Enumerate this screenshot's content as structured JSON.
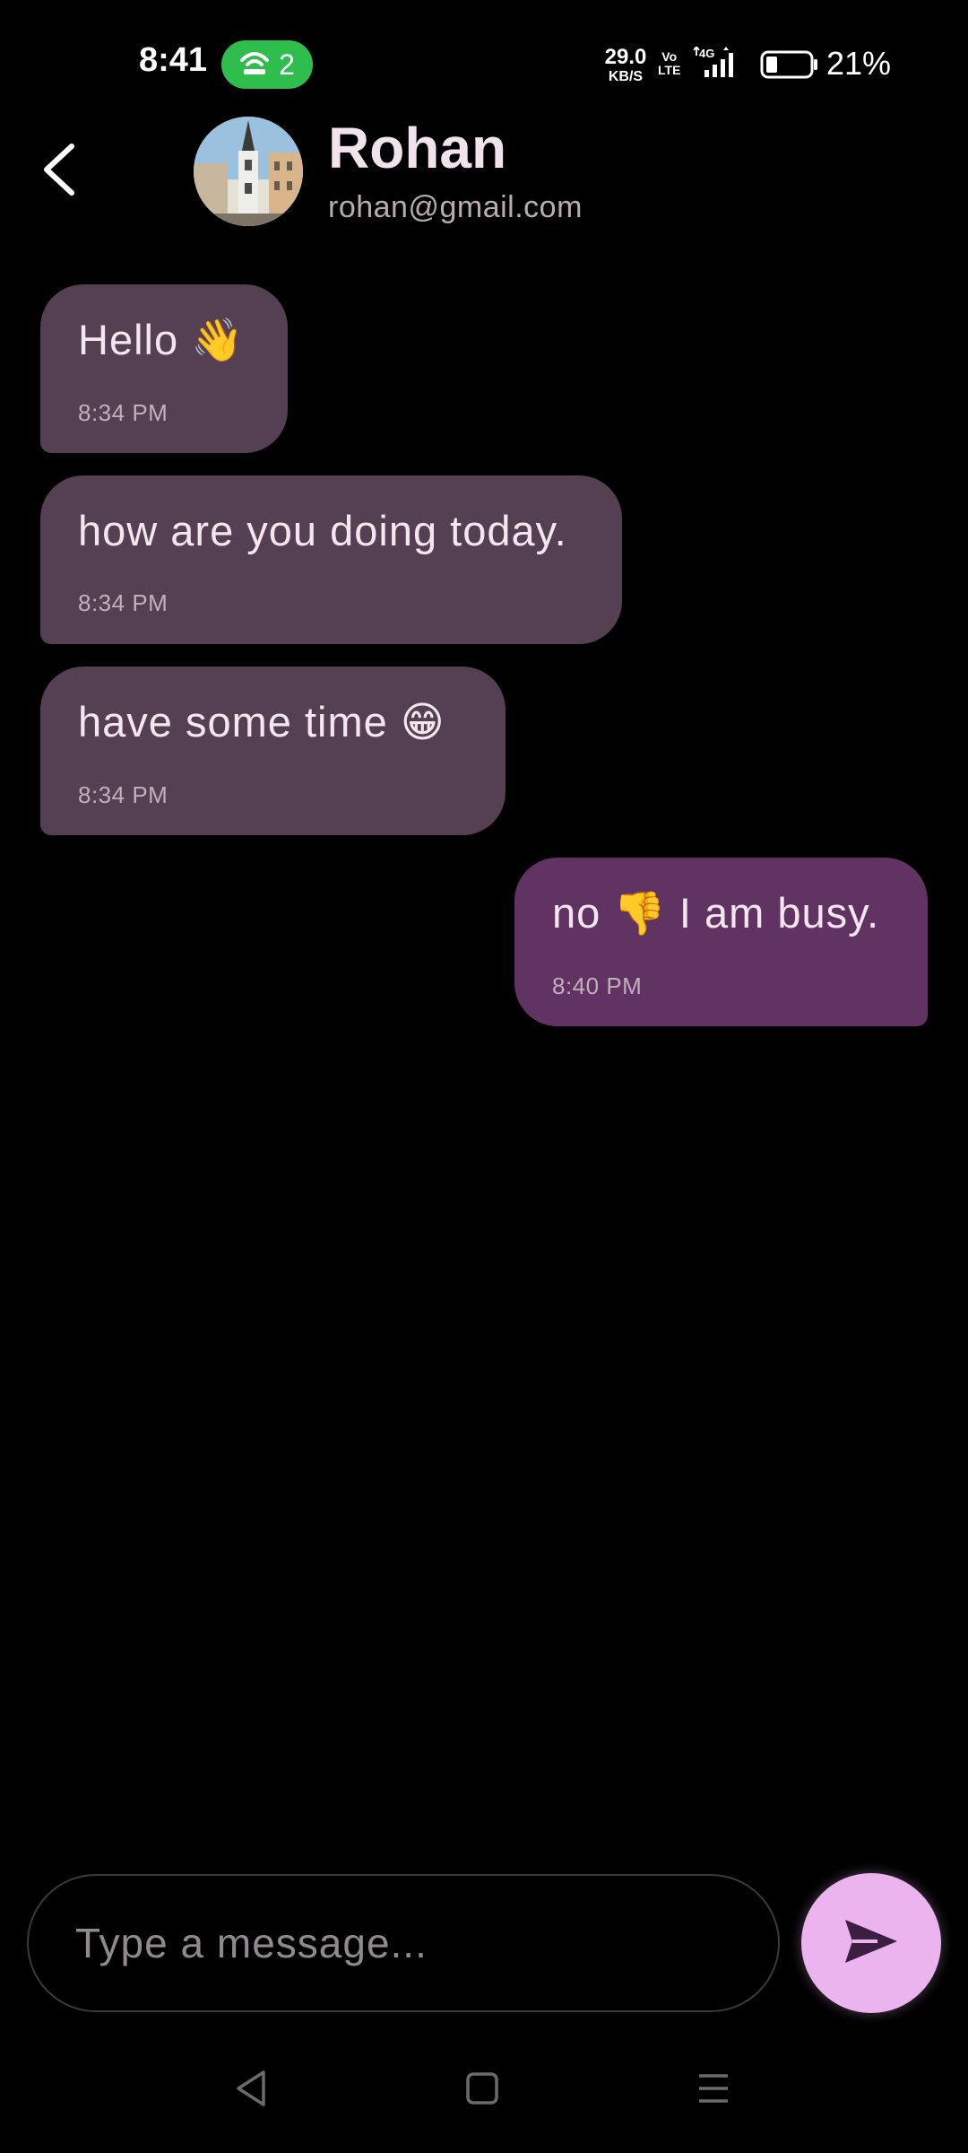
{
  "status_bar": {
    "time": "8:41",
    "hotspot_count": "2",
    "net_speed_value": "29.0",
    "net_speed_unit": "KB/S",
    "volte_top": "Vo",
    "volte_bottom": "LTE",
    "network": "4G",
    "battery_percent": "21%",
    "icons": [
      "hotspot-icon",
      "signal-icon",
      "battery-icon"
    ]
  },
  "header": {
    "name": "Rohan",
    "email": "rohan@gmail.com",
    "back_icon": "chevron-left-icon"
  },
  "messages": [
    {
      "direction": "incoming",
      "text": "Hello 👋",
      "time": "8:34 PM"
    },
    {
      "direction": "incoming",
      "text": "how are you doing today.",
      "time": "8:34 PM"
    },
    {
      "direction": "incoming",
      "text": "have some time 😁",
      "time": "8:34 PM"
    },
    {
      "direction": "outgoing",
      "text": "no 👎 I am busy.",
      "time": "8:40 PM"
    }
  ],
  "composer": {
    "placeholder": "Type a message...",
    "send_icon": "send-icon"
  },
  "nav_bar": {
    "icons": [
      "back-triangle-icon",
      "home-square-icon",
      "menu-lines-icon"
    ]
  },
  "colors": {
    "background": "#000000",
    "incoming_bubble": "#553f52",
    "outgoing_bubble": "#613363",
    "send_button": "#ecb4ee",
    "hotspot_pill": "#2fbe4e"
  }
}
